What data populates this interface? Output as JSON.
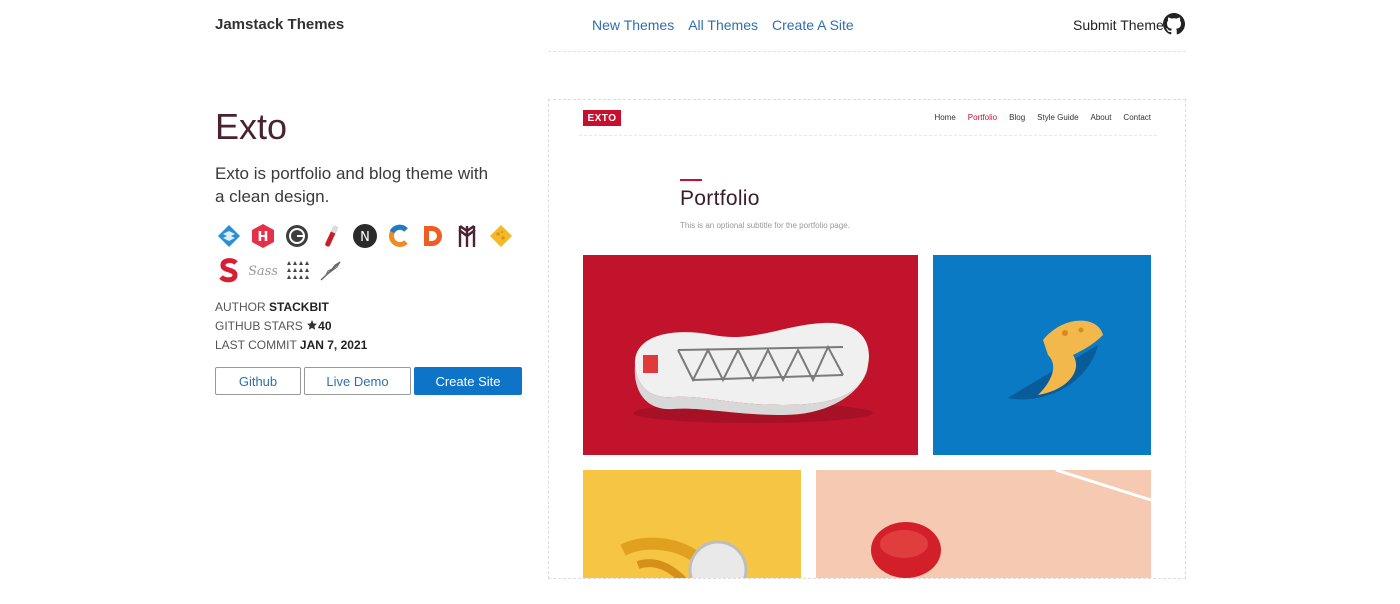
{
  "header": {
    "brand": "Jamstack Themes",
    "nav": [
      "New Themes",
      "All Themes",
      "Create A Site"
    ],
    "submit": "Submit Theme"
  },
  "theme": {
    "title": "Exto",
    "description": "Exto is portfolio and blog theme with a clean design.",
    "tech_icons": [
      "stackbit-icon",
      "hugo-icon",
      "gatsby-icon",
      "jekyll-icon",
      "nextjs-icon",
      "cd-icon",
      "d-icon",
      "tree-icon",
      "cheese-icon",
      "s-icon",
      "sass-icon",
      "triangles-icon",
      "quill-icon"
    ],
    "meta": {
      "author_label": "AUTHOR",
      "author": "STACKBIT",
      "stars_label": "GITHUB STARS",
      "stars": "40",
      "commit_label": "LAST COMMIT",
      "commit": "JAN 7, 2021"
    },
    "buttons": {
      "github": "Github",
      "demo": "Live Demo",
      "create": "Create Site"
    }
  },
  "preview": {
    "logo": "EXTO",
    "nav": [
      "Home",
      "Portfolio",
      "Blog",
      "Style Guide",
      "About",
      "Contact"
    ],
    "active_nav": "Portfolio",
    "title": "Portfolio",
    "subtitle": "This is an optional subtitle for the portfolio page.",
    "tile_colors": [
      "#c1142c",
      "#0a7ac5",
      "#f6c544",
      "#f6c9b3"
    ]
  },
  "colors": {
    "link": "#2f6fb0",
    "primary": "#0d74c8",
    "accent": "#c8102e",
    "title": "#4a2232"
  }
}
